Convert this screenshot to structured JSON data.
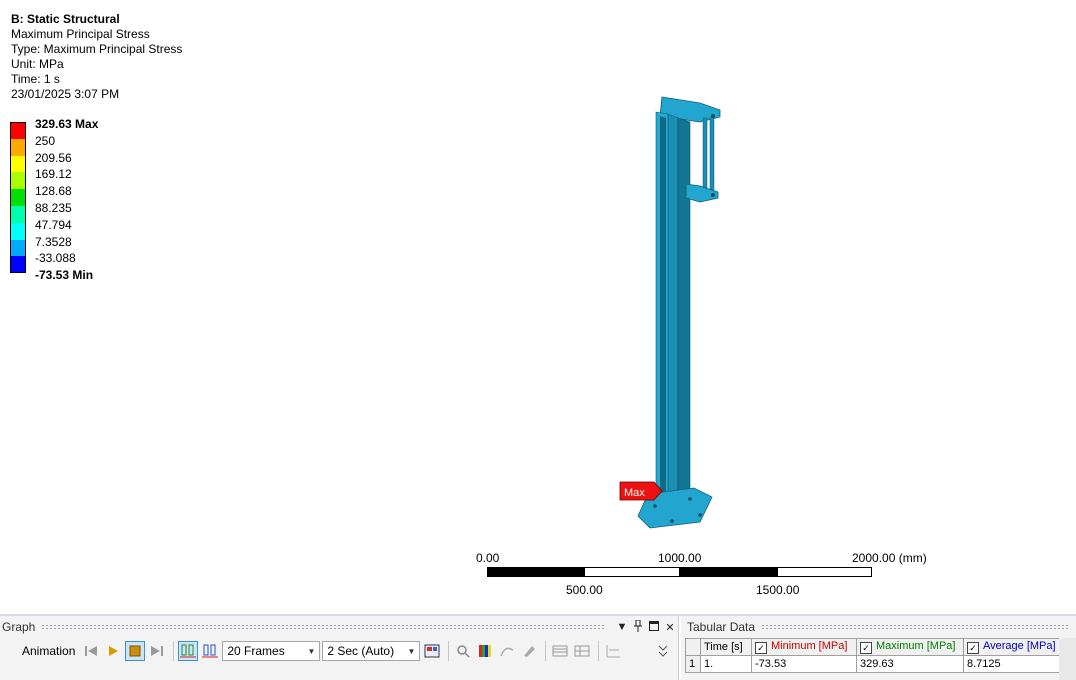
{
  "result_info": {
    "title": "B: Static Structural",
    "result_name": "Maximum Principal Stress",
    "type": "Type: Maximum Principal Stress",
    "unit": "Unit: MPa",
    "time": "Time: 1 s",
    "date": "23/01/2025 3:07 PM"
  },
  "legend": {
    "labels": [
      "329.63 Max",
      "250",
      "209.56",
      "169.12",
      "128.68",
      "88.235",
      "47.794",
      "7.3528",
      "-33.088",
      "-73.53 Min"
    ],
    "colors": [
      "#ff0000",
      "#ffaa00",
      "#ffff00",
      "#aaff00",
      "#00e000",
      "#00ffaa",
      "#00ffff",
      "#00aaff",
      "#0000ff"
    ]
  },
  "viewport": {
    "max_probe_label": "Max",
    "model_color": "#1b9ac4"
  },
  "scale_bar": {
    "top_labels": [
      "0.00",
      "1000.00",
      "2000.00 (mm)"
    ],
    "bottom_labels": [
      "500.00",
      "1500.00"
    ]
  },
  "graph_panel": {
    "title": "Graph",
    "animation_label": "Animation",
    "frames": "20 Frames",
    "duration": "2 Sec (Auto)"
  },
  "tabular_data": {
    "title": "Tabular Data",
    "headers": [
      "Time [s]",
      "Minimum [MPa]",
      "Maximum [MPa]",
      "Average [MPa]"
    ],
    "header_colors": [
      "#000000",
      "#c00000",
      "#008000",
      "#0000c0"
    ],
    "rows": [
      {
        "index": "1",
        "cells": [
          "1.",
          "-73.53",
          "329.63",
          "8.7125"
        ]
      }
    ]
  }
}
